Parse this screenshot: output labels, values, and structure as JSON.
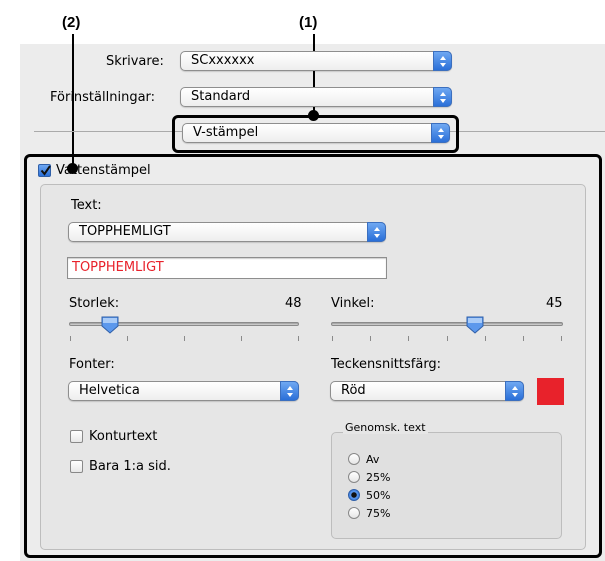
{
  "callouts": {
    "one": "(1)",
    "two": "(2)"
  },
  "printer": {
    "label": "Skrivare:",
    "value": "SCxxxxxx"
  },
  "presets": {
    "label": "Förinställningar:",
    "value": "Standard"
  },
  "panel_popup": {
    "value": "V-stämpel"
  },
  "watermark": {
    "checkbox_label": "Vattenstämpel",
    "checked": true,
    "text_label": "Text:",
    "text_popup": "TOPPHEMLIGT",
    "text_field": "TOPPHEMLIGT",
    "text_field_color": "#e8222b",
    "size": {
      "label": "Storlek:",
      "value": "48",
      "fraction": 0.18
    },
    "angle": {
      "label": "Vinkel:",
      "value": "45",
      "fraction": 0.62
    },
    "font": {
      "label": "Fonter:",
      "value": "Helvetica"
    },
    "font_color": {
      "label": "Teckensnittsfärg:",
      "value": "Röd",
      "swatch": "#e8222b"
    },
    "outline": {
      "label": "Konturtext",
      "checked": false
    },
    "first_page": {
      "label": "Bara 1:a sid.",
      "checked": false
    },
    "transparency": {
      "title": "Genomsk. text",
      "options": [
        "Av",
        "25%",
        "50%",
        "75%"
      ],
      "selected": "50%"
    }
  },
  "colors": {
    "accent": "#2a6fd8",
    "window_bg": "#ececec"
  }
}
